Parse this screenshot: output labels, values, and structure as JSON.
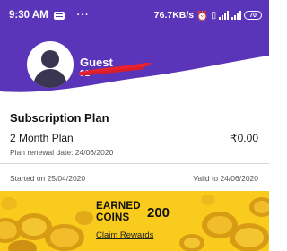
{
  "status_bar": {
    "time": "9:30 AM",
    "more": "···",
    "network_speed": "76.7KB/s",
    "battery": "70"
  },
  "profile": {
    "name": "Guest",
    "phone_prefix": "91"
  },
  "subscription": {
    "section_title": "Subscription Plan",
    "plan_name": "2 Month Plan",
    "price": "₹0.00",
    "renewal": "Plan renewal date: 24/06/2020",
    "started": "Started on 25/04/2020",
    "valid_to": "Valid to 24/06/2020"
  },
  "rewards": {
    "earned_line1": "EARNED",
    "earned_line2": "COINS",
    "coin_count": "200",
    "claim_label": "Claim Rewards"
  },
  "colors": {
    "header": "#5b35b9",
    "banner": "#f9cb1c",
    "coin": "#e0a81c"
  }
}
